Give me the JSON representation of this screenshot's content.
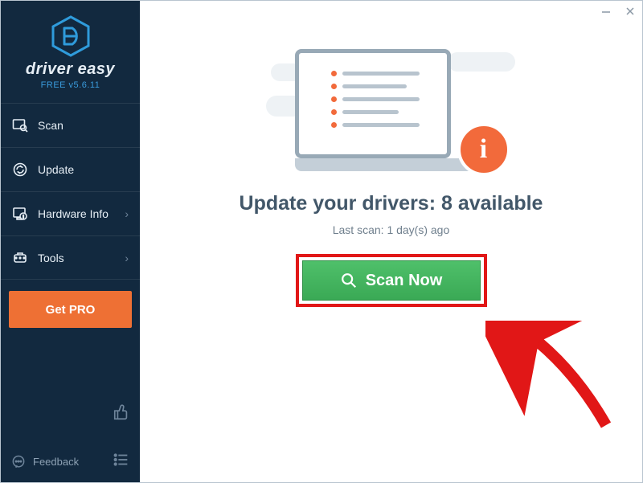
{
  "brand": "driver easy",
  "version": "FREE v5.6.11",
  "sidebar": {
    "items": [
      {
        "label": "Scan",
        "has_sub": false
      },
      {
        "label": "Update",
        "has_sub": false
      },
      {
        "label": "Hardware Info",
        "has_sub": true
      },
      {
        "label": "Tools",
        "has_sub": true
      }
    ],
    "get_pro": "Get PRO",
    "feedback": "Feedback"
  },
  "main": {
    "headline_prefix": "Update your drivers: ",
    "available_count": "8",
    "headline_suffix": " available",
    "last_scan": "Last scan: 1 day(s) ago",
    "scan_label": "Scan Now"
  }
}
